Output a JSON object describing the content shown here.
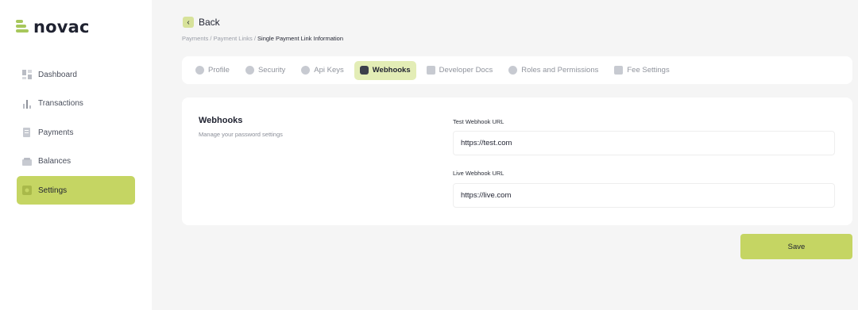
{
  "brand": {
    "name": "novac",
    "accent": "#c5d563"
  },
  "sidebar": {
    "items": [
      {
        "label": "Dashboard",
        "icon": "dashboard-icon",
        "active": false
      },
      {
        "label": "Transactions",
        "icon": "bar-chart-icon",
        "active": false
      },
      {
        "label": "Payments",
        "icon": "document-icon",
        "active": false
      },
      {
        "label": "Balances",
        "icon": "wallet-icon",
        "active": false
      },
      {
        "label": "Settings",
        "icon": "settings-icon",
        "active": true
      }
    ]
  },
  "header": {
    "back_label": "Back",
    "breadcrumb": {
      "part1": "Payments / Payment Links / ",
      "current": "Single Payment Link Information"
    }
  },
  "tabs": [
    {
      "label": "Profile",
      "icon": "user-icon"
    },
    {
      "label": "Security",
      "icon": "lock-icon"
    },
    {
      "label": "Api Keys",
      "icon": "gear-icon"
    },
    {
      "label": "Webhooks",
      "icon": "webhook-icon",
      "active": true
    },
    {
      "label": "Developer Docs",
      "icon": "doc-icon"
    },
    {
      "label": "Roles and Permissions",
      "icon": "roles-icon"
    },
    {
      "label": "Fee Settings",
      "icon": "fee-icon"
    }
  ],
  "webhooks": {
    "title": "Webhooks",
    "description": "Manage your password settings",
    "test_label": "Test Webhook URL",
    "test_value": "https://test.com",
    "live_label": "Live Webhook URL",
    "live_value": "https://live.com"
  },
  "save_label": "Save"
}
